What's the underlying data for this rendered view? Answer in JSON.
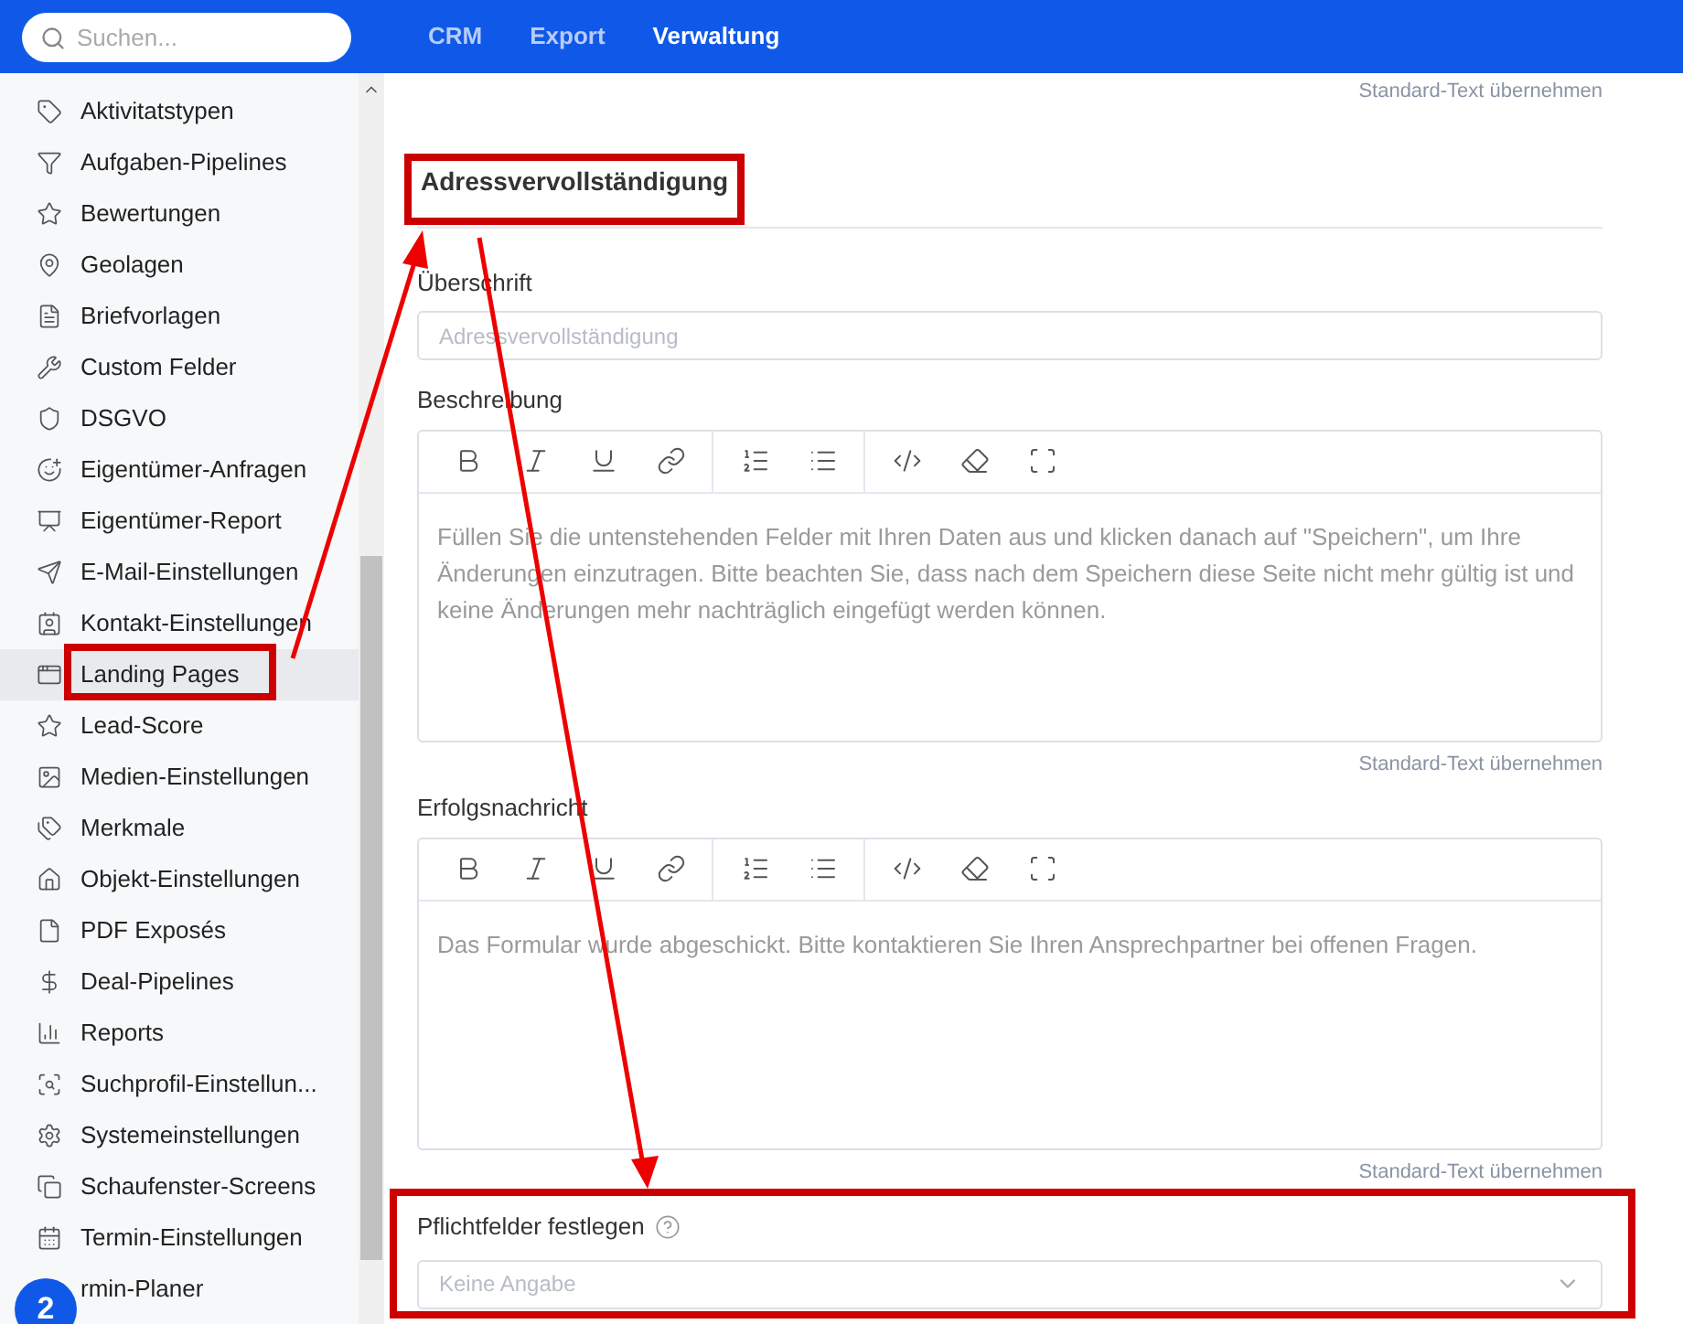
{
  "topbar": {
    "search": {
      "placeholder": "Suchen..."
    },
    "nav": [
      {
        "label": "CRM",
        "selected": false
      },
      {
        "label": "Export",
        "selected": false
      },
      {
        "label": "Verwaltung",
        "selected": true
      }
    ]
  },
  "sidebar": {
    "items": [
      {
        "label": "Aktivitatstypen",
        "selected": false
      },
      {
        "label": "Aufgaben-Pipelines",
        "selected": false
      },
      {
        "label": "Bewertungen",
        "selected": false
      },
      {
        "label": "Geolagen",
        "selected": false
      },
      {
        "label": "Briefvorlagen",
        "selected": false
      },
      {
        "label": "Custom Felder",
        "selected": false
      },
      {
        "label": "DSGVO",
        "selected": false
      },
      {
        "label": "Eigentümer-Anfragen",
        "selected": false
      },
      {
        "label": "Eigentümer-Report",
        "selected": false
      },
      {
        "label": "E-Mail-Einstellungen",
        "selected": false
      },
      {
        "label": "Kontakt-Einstellungen",
        "selected": false
      },
      {
        "label": "Landing Pages",
        "selected": true
      },
      {
        "label": "Lead-Score",
        "selected": false
      },
      {
        "label": "Medien-Einstellungen",
        "selected": false
      },
      {
        "label": "Merkmale",
        "selected": false
      },
      {
        "label": "Objekt-Einstellungen",
        "selected": false
      },
      {
        "label": "PDF Exposés",
        "selected": false
      },
      {
        "label": "Deal-Pipelines",
        "selected": false
      },
      {
        "label": "Reports",
        "selected": false
      },
      {
        "label": "Suchprofil-Einstellun...",
        "selected": false
      },
      {
        "label": "Systemeinstellungen",
        "selected": false
      },
      {
        "label": "Schaufenster-Screens",
        "selected": false
      },
      {
        "label": "Termin-Einstellungen",
        "selected": false
      },
      {
        "label": "rmin-Planer",
        "selected": false
      }
    ],
    "help_badge": "2"
  },
  "main": {
    "top_link": "Standard-Text übernehmen",
    "section_title": "Adressvervollständigung",
    "fields": [
      {
        "kind": "input",
        "label": "Überschrift",
        "placeholder": "Adressvervollständigung"
      },
      {
        "kind": "editor",
        "label": "Beschreibung",
        "text": "Füllen Sie die untenstehenden Felder mit Ihren Daten aus und klicken danach auf \"Speichern\", um Ihre Änderungen einzutragen. Bitte beachten Sie, dass nach dem Speichern diese Seite nicht mehr gültig ist und keine Änderungen mehr nachträglich eingefügt werden können.",
        "link": "Standard-Text übernehmen"
      },
      {
        "kind": "editor",
        "label": "Erfolgsnachricht",
        "text": "Das Formular wurde abgeschickt. Bitte kontaktieren Sie Ihren Ansprechpartner bei offenen Fragen.",
        "link": "Standard-Text übernehmen"
      },
      {
        "kind": "select",
        "label": "Pflichtfelder festlegen",
        "placeholder": "Keine Angabe"
      }
    ]
  }
}
